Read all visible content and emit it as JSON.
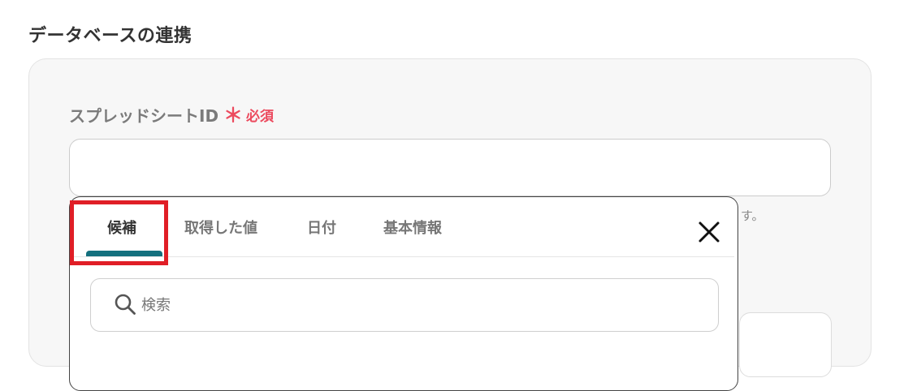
{
  "section": {
    "title": "データベースの連携"
  },
  "field": {
    "label": "スプレッドシートID",
    "required_mark": "＊",
    "required_text": "必須",
    "value": "",
    "hint_tail": "す。"
  },
  "popup": {
    "tabs": [
      {
        "label": "候補",
        "active": true
      },
      {
        "label": "取得した値",
        "active": false
      },
      {
        "label": "日付",
        "active": false
      },
      {
        "label": "基本情報",
        "active": false
      }
    ],
    "close_icon": "close-icon",
    "search": {
      "placeholder": "検索",
      "value": ""
    }
  },
  "colors": {
    "required": "#ec4a5e",
    "tab_indicator": "#14707e",
    "highlight": "#e01e26"
  }
}
